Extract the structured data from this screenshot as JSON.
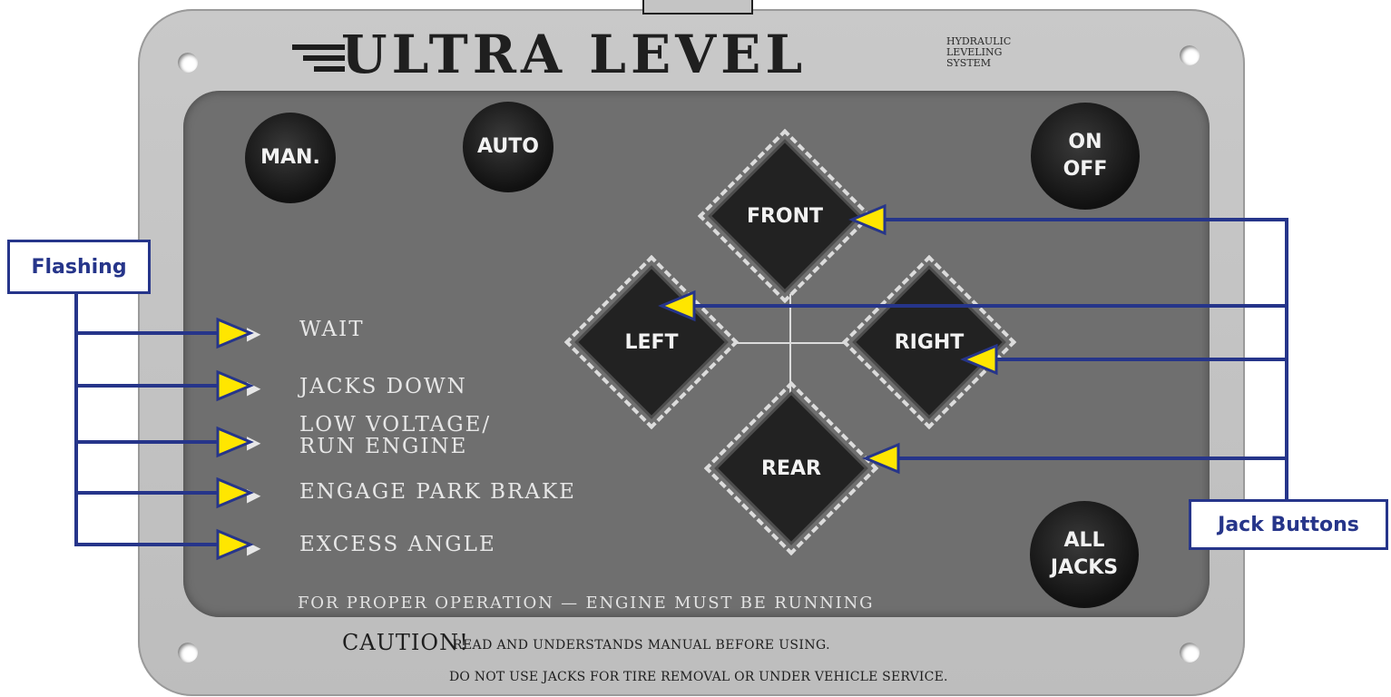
{
  "brand": {
    "name": "ULTRA LEVEL",
    "tagline_line1": "HYDRAULIC",
    "tagline_line2": "LEVELING",
    "tagline_line3": "SYSTEM"
  },
  "buttons": {
    "manual": "MAN.",
    "auto": "AUTO",
    "power_line1": "ON",
    "power_line2": "OFF",
    "all_jacks_line1": "ALL",
    "all_jacks_line2": "JACKS"
  },
  "jack_buttons": {
    "front": "FRONT",
    "left": "LEFT",
    "right": "RIGHT",
    "rear": "REAR"
  },
  "status_lights": {
    "wait": "WAIT",
    "jacks_down": "JACKS DOWN",
    "low_voltage_line1": "LOW VOLTAGE/",
    "low_voltage_line2": "RUN ENGINE",
    "park_brake": "ENGAGE PARK BRAKE",
    "excess_angle": "EXCESS ANGLE"
  },
  "panel_footer": "FOR PROPER OPERATION — ENGINE MUST BE RUNNING",
  "caution": {
    "heading": "CAUTION!",
    "line1": "READ AND UNDERSTANDS MANUAL BEFORE USING.",
    "line2": "DO NOT USE JACKS FOR TIRE REMOVAL OR UNDER VEHICLE SERVICE."
  },
  "callouts": {
    "flashing": "Flashing",
    "jack_buttons": "Jack Buttons"
  },
  "colors": {
    "callout": "#26358a",
    "arrowhead": "#ffe600",
    "panel": "#6f6f6f",
    "plate": "#c4c4c4"
  },
  "icons": {
    "status_indicator": "triangle-right-icon",
    "callout_arrow": "yellow-arrowhead-icon"
  }
}
